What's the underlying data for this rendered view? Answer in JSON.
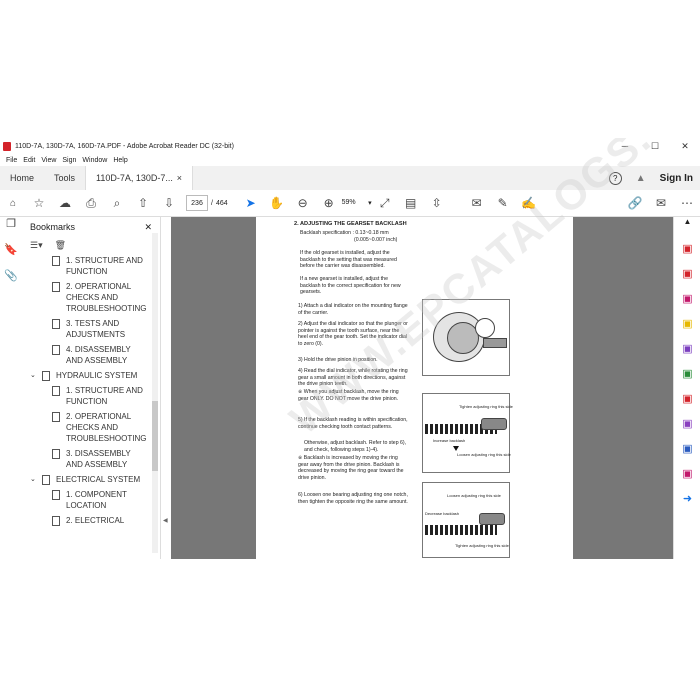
{
  "window": {
    "title": "110D-7A, 130D-7A, 160D-7A.PDF - Adobe Acrobat Reader DC (32-bit)",
    "minimize": "─",
    "maximize": "☐",
    "close": "✕"
  },
  "menu": [
    "File",
    "Edit",
    "View",
    "Sign",
    "Window",
    "Help"
  ],
  "tabs": {
    "home": "Home",
    "tools": "Tools",
    "doc": "110D-7A, 130D-7...",
    "doc_close": "×"
  },
  "header_right": {
    "help": "?",
    "bell": "🔔",
    "signin": "Sign In"
  },
  "toolbar": {
    "page_current": "236",
    "page_sep": "/",
    "page_total": "464",
    "zoom": "59%"
  },
  "bookmarks": {
    "title": "Bookmarks",
    "close": "✕",
    "items": [
      {
        "label": "1. STRUCTURE AND FUNCTION"
      },
      {
        "label": "2. OPERATIONAL CHECKS AND TROUBLESHOOTING"
      },
      {
        "label": "3. TESTS AND ADJUSTMENTS"
      },
      {
        "label": "4. DISASSEMBLY AND ASSEMBLY"
      },
      {
        "label": "HYDRAULIC SYSTEM"
      },
      {
        "label": "1. STRUCTURE AND FUNCTION"
      },
      {
        "label": "2. OPERATIONAL CHECKS AND TROUBLESHOOTING"
      },
      {
        "label": "3. DISASSEMBLY AND ASSEMBLY"
      },
      {
        "label": "ELECTRICAL SYSTEM"
      },
      {
        "label": "1. COMPONENT LOCATION"
      },
      {
        "label": "2. ELECTRICAL"
      }
    ]
  },
  "doc": {
    "heading": "2. ADJUSTING THE GEARSET BACKLASH",
    "spec1": "Backlash specification : 0.13~0.18 mm",
    "spec2": "(0.005~0.007 inch)",
    "p1": "If the old gearset is installed, adjust the backlash to the setting that was measured before the carrier was disassembled.",
    "p2": "If a new gearset is installed, adjust the backlash to the correct specification for new gearsets.",
    "s1": "1) Attach a dial indicator on the mounting flange of the carrier.",
    "s2": "2) Adjust the dial indicator so that the plunger or pointer is against the tooth surface, near the heel end of the gear tooth. Set the indicator dial to zero (0).",
    "s3": "3) Hold the drive pinion in position.",
    "s4": "4) Read the dial indicator, while rotating the ring gear a small amount in both directions, against the drive pinion teeth.",
    "s4a": "※ When you adjust backlash, move the ring gear ONLY. DO NOT move the drive pinion.",
    "s5": "5) If the backlash reading is within specification, continue checking tooth contact patterns.",
    "s5b": "Otherwise, adjust backlash. Refer to step 6), and check, following steps 1)-4).",
    "s5c": "※ Backlash is increased by moving the ring gear away from the drive pinion. Backlash is decreased by moving the ring gear toward the drive pinion.",
    "s6": "6) Loosen one bearing adjusting ring one notch, then tighten the opposite ring the same amount.",
    "fig2_top": "Tighten adjusting ring this side",
    "fig2_mid": "Increase backlash",
    "fig2_bot": "Loosen adjusting ring this side",
    "fig3_top": "Loosen adjusting ring this side",
    "fig3_mid": "Decrease backlash",
    "fig3_bot": "Tighten adjusting ring this side"
  },
  "watermark": "WWW.EPCATALOGS.COM",
  "colors": {
    "accent": "#1473e6",
    "pdf_red": "#d3232a",
    "canvas": "#777777"
  }
}
